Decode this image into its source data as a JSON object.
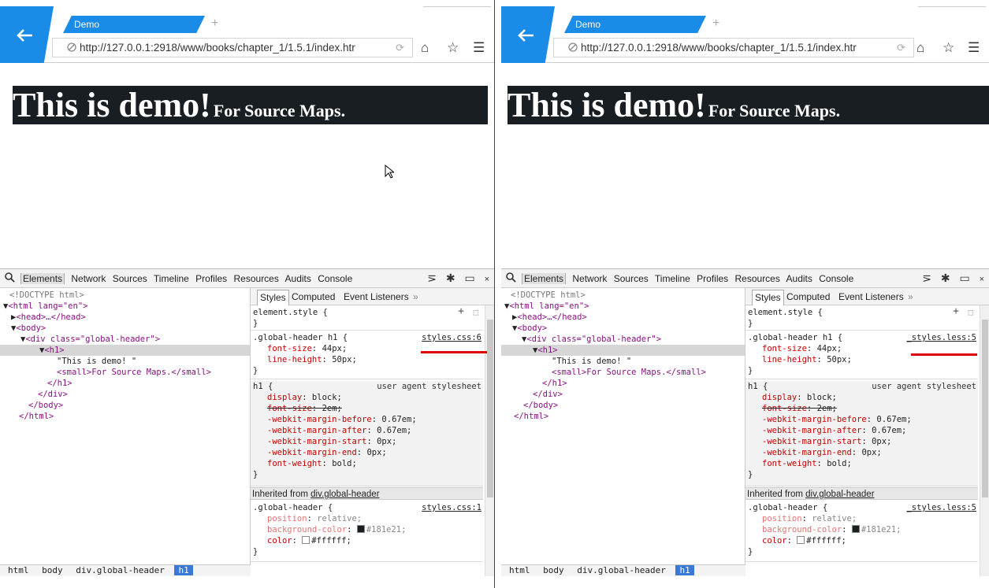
{
  "windows": [
    {
      "tab_title": "Demo",
      "new_tab": "+",
      "url": "http://127.0.0.1:2918/www/books/chapter_1/1.5.1/index.htr",
      "page": {
        "heading": "This is demo!",
        "small": "For Source Maps."
      },
      "devtools": {
        "panels": [
          "Elements",
          "Network",
          "Sources",
          "Timeline",
          "Profiles",
          "Resources",
          "Audits",
          "Console"
        ],
        "dom": {
          "doctype": "<!DOCTYPE html>",
          "html_open": "<html lang=\"en\">",
          "head": "<head>…</head>",
          "body_open": "<body>",
          "div_open": "<div class=\"global-header\">",
          "h1_open": "<h1>",
          "text": "\"This is demo! \"",
          "small": "<small>For Source Maps.</small>",
          "h1_close": "</h1>",
          "div_close": "</div>",
          "body_close": "</body>",
          "html_close": "</html>"
        },
        "styles_tabs": {
          "styles": "Styles",
          "computed": "Computed",
          "listeners": "Event Listeners",
          "more": "»"
        },
        "element_style": "element.style {",
        "rule1": {
          "selector": ".global-header h1 {",
          "source": "styles.css:6",
          "p1": "font-size",
          "v1": "44px;",
          "p2": "line-height",
          "v2": "50px;"
        },
        "ua_rule": {
          "selector": "h1 {",
          "label": "user agent stylesheet",
          "lines": [
            {
              "p": "display",
              "v": "block;"
            },
            {
              "p": "font-size",
              "v": "2em;"
            },
            {
              "p": "-webkit-margin-before",
              "v": "0.67em;"
            },
            {
              "p": "-webkit-margin-after",
              "v": "0.67em;"
            },
            {
              "p": "-webkit-margin-start",
              "v": "0px;"
            },
            {
              "p": "-webkit-margin-end",
              "v": "0px;"
            },
            {
              "p": "font-weight",
              "v": "bold;"
            }
          ]
        },
        "inherited_label": "Inherited from ",
        "inherited_from": "div.global-header",
        "rule3": {
          "selector": ".global-header {",
          "source": "styles.css:1",
          "p1": "position",
          "v1": "relative;",
          "p2": "background-color",
          "v2": "#181e21;",
          "p3": "color",
          "v3": "#ffffff;"
        },
        "breadcrumbs": [
          "html",
          "body",
          "div.global-header",
          "h1"
        ]
      }
    },
    {
      "tab_title": "Demo",
      "new_tab": "+",
      "url": "http://127.0.0.1:2918/www/books/chapter_1/1.5.1/index.htr",
      "page": {
        "heading": "This is demo!",
        "small": "For Source Maps."
      },
      "devtools": {
        "panels": [
          "Elements",
          "Network",
          "Sources",
          "Timeline",
          "Profiles",
          "Resources",
          "Audits",
          "Console"
        ],
        "dom": {
          "doctype": "<!DOCTYPE html>",
          "html_open": "<html lang=\"en\">",
          "head": "<head>…</head>",
          "body_open": "<body>",
          "div_open": "<div class=\"global-header\">",
          "h1_open": "<h1>",
          "text": "\"This is demo! \"",
          "small": "<small>For Source Maps.</small>",
          "h1_close": "</h1>",
          "div_close": "</div>",
          "body_close": "</body>",
          "html_close": "</html>"
        },
        "styles_tabs": {
          "styles": "Styles",
          "computed": "Computed",
          "listeners": "Event Listeners",
          "more": "»"
        },
        "element_style": "element.style {",
        "rule1": {
          "selector": ".global-header h1 {",
          "source": "_styles.less:5",
          "p1": "font-size",
          "v1": "44px;",
          "p2": "line-height",
          "v2": "50px;"
        },
        "ua_rule": {
          "selector": "h1 {",
          "label": "user agent stylesheet",
          "lines": [
            {
              "p": "display",
              "v": "block;"
            },
            {
              "p": "font-size",
              "v": "2em;"
            },
            {
              "p": "-webkit-margin-before",
              "v": "0.67em;"
            },
            {
              "p": "-webkit-margin-after",
              "v": "0.67em;"
            },
            {
              "p": "-webkit-margin-start",
              "v": "0px;"
            },
            {
              "p": "-webkit-margin-end",
              "v": "0px;"
            },
            {
              "p": "font-weight",
              "v": "bold;"
            }
          ]
        },
        "inherited_label": "Inherited from ",
        "inherited_from": "div.global-header",
        "rule3": {
          "selector": ".global-header {",
          "source": "_styles.less:5",
          "p1": "position",
          "v1": "relative;",
          "p2": "background-color",
          "v2": "#181e21;",
          "p3": "color",
          "v3": "#ffffff;"
        },
        "breadcrumbs": [
          "html",
          "body",
          "div.global-header",
          "h1"
        ]
      }
    }
  ],
  "colors": {
    "accent": "#1a8ce8",
    "header_bg": "#181e21",
    "highlight": "#d00000",
    "crumb_active": "#3a7ad6"
  },
  "icons": [
    "back-arrow-icon",
    "no-entry-icon",
    "reload-icon",
    "home-icon",
    "star-icon",
    "menu-icon",
    "search-icon",
    "console-drawer-icon",
    "gear-icon",
    "dock-icon",
    "close-icon",
    "new-style-rule-icon",
    "element-state-icon",
    "cursor-icon"
  ]
}
